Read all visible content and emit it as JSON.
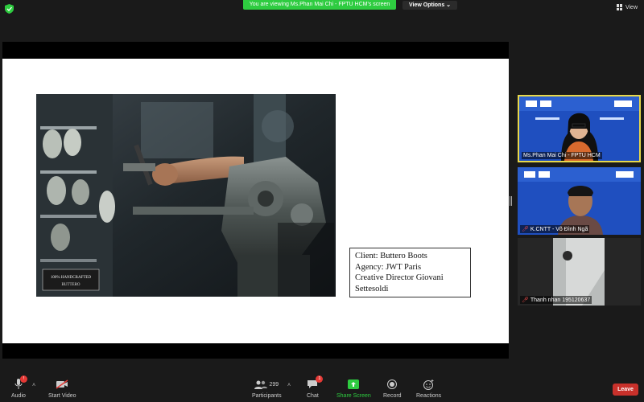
{
  "top_bar": {
    "share_banner": "You are viewing Ms.Phan Mai Chi - FPTU HCM's screen",
    "view_options": "View Options ⌄",
    "view_button": "View",
    "icons": [
      "shield-icon",
      "grid-icon"
    ],
    "shield_color": "#2ecc40"
  },
  "slide": {
    "photo_overlay_lines": [
      "100% HANDCRAFTED",
      "BUTTERO"
    ],
    "info_box": {
      "client": "Client: Buttero Boots",
      "agency": "Agency: JWT Paris",
      "creative_director": "Creative Director Giovani Settesoldi"
    }
  },
  "participants_panel": [
    {
      "name": "Ms.Phan Mai Chi - FPTU HCM",
      "muted": false,
      "active_speaker": true
    },
    {
      "name": "K.CNTT - Võ Đình Ngã",
      "muted": true,
      "active_speaker": false
    },
    {
      "name": "Thanh nhan 195120637",
      "muted": true,
      "active_speaker": false
    }
  ],
  "toolbar": {
    "audio": "Audio",
    "start_video": "Start Video",
    "participants": "Participants",
    "participants_count": "299",
    "chat": "Chat",
    "chat_badge": "1",
    "share_screen": "Share Screen",
    "record": "Record",
    "reactions": "Reactions",
    "leave": "Leave",
    "audio_badge": "!"
  },
  "colors": {
    "share_green": "#2ecc40",
    "leave_red": "#c8312b",
    "active_speaker_border": "#e8d84a",
    "banner_blue": "#1a3fa8"
  }
}
